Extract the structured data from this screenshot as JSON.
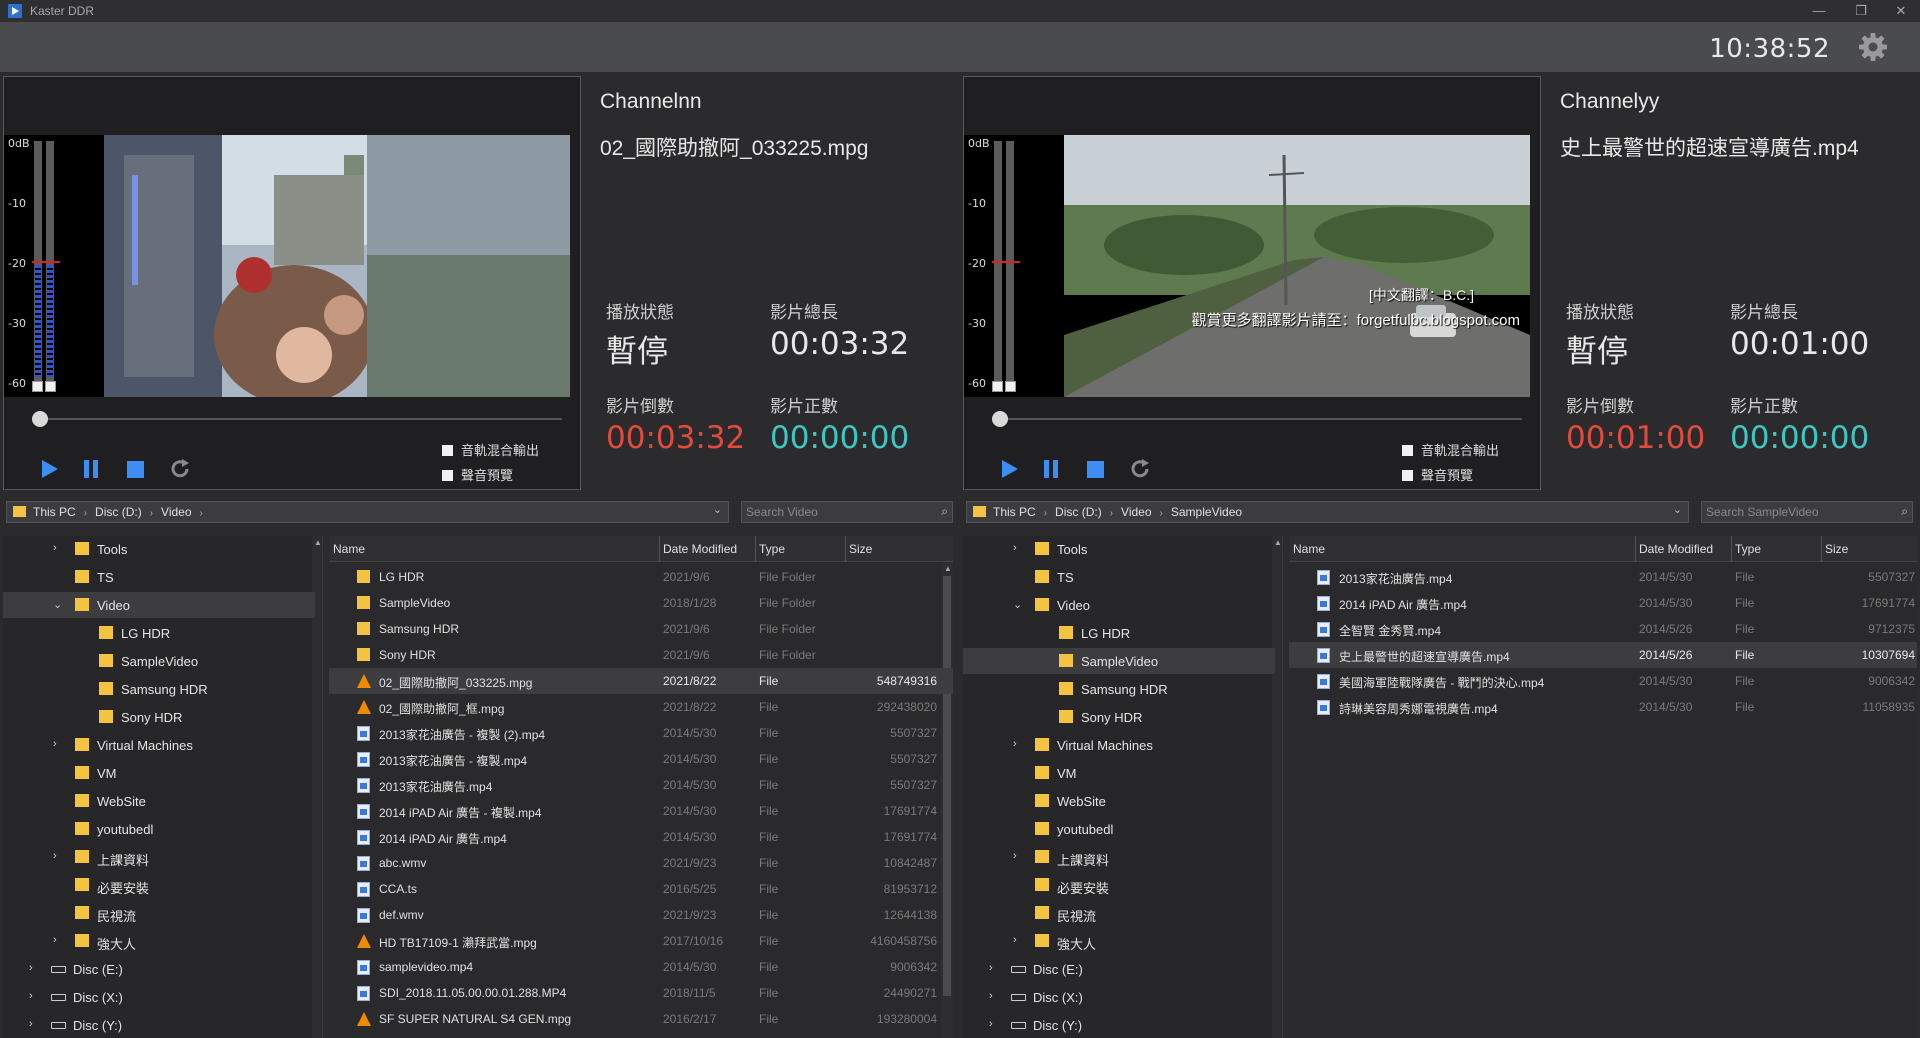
{
  "window": {
    "title": "Kaster DDR"
  },
  "clock": "10:38:52",
  "colors": {
    "countdown": "#e24b3b",
    "countup": "#3ec7c0",
    "folder": "#f5c342"
  },
  "meter": {
    "labels": [
      "0dB",
      "-10",
      "-20",
      "-30",
      "-60"
    ]
  },
  "options": {
    "mix_out": "音軌混合輸出",
    "preview": "聲音預覽"
  },
  "labels": {
    "status": "播放狀態",
    "duration": "影片總長",
    "countdown": "影片倒數",
    "countup": "影片正數"
  },
  "channels": [
    {
      "name": "Channelnn",
      "file": "02_國際助撤阿_033225.mpg",
      "status": "暫停",
      "duration": "00:03:32",
      "countdown": "00:03:32",
      "countup": "00:00:00",
      "path": [
        "This PC",
        "Disc (D:)",
        "Video"
      ],
      "search_placeholder": "Search Video",
      "tree": [
        {
          "label": "Tools",
          "chev": "right",
          "type": "folder",
          "indent": 1
        },
        {
          "label": "TS",
          "chev": "",
          "type": "folder",
          "indent": 1
        },
        {
          "label": "Video",
          "chev": "down",
          "type": "folder",
          "indent": 1,
          "selected": true
        },
        {
          "label": "LG HDR",
          "chev": "",
          "type": "folder",
          "indent": 2
        },
        {
          "label": "SampleVideo",
          "chev": "",
          "type": "folder",
          "indent": 2
        },
        {
          "label": "Samsung HDR",
          "chev": "",
          "type": "folder",
          "indent": 2
        },
        {
          "label": "Sony HDR",
          "chev": "",
          "type": "folder",
          "indent": 2
        },
        {
          "label": "Virtual Machines",
          "chev": "right",
          "type": "folder",
          "indent": 1
        },
        {
          "label": "VM",
          "chev": "",
          "type": "folder",
          "indent": 1
        },
        {
          "label": "WebSite",
          "chev": "",
          "type": "folder",
          "indent": 1
        },
        {
          "label": "youtubedl",
          "chev": "",
          "type": "folder",
          "indent": 1
        },
        {
          "label": "上課資料",
          "chev": "right",
          "type": "folder",
          "indent": 1
        },
        {
          "label": "必要安裝",
          "chev": "",
          "type": "folder",
          "indent": 1
        },
        {
          "label": "民視流",
          "chev": "",
          "type": "folder",
          "indent": 1
        },
        {
          "label": "強大人",
          "chev": "right",
          "type": "folder",
          "indent": 1
        },
        {
          "label": "Disc (E:)",
          "chev": "right",
          "type": "disk",
          "indent": 0
        },
        {
          "label": "Disc (X:)",
          "chev": "right",
          "type": "disk",
          "indent": 0
        },
        {
          "label": "Disc (Y:)",
          "chev": "right",
          "type": "disk",
          "indent": 0
        }
      ],
      "columns": [
        "Name",
        "Date Modified",
        "Type",
        "Size"
      ],
      "files": [
        {
          "icon": "folder",
          "name": "LG HDR",
          "date": "2021/9/6",
          "type": "File Folder",
          "size": ""
        },
        {
          "icon": "folder",
          "name": "SampleVideo",
          "date": "2018/1/28",
          "type": "File Folder",
          "size": ""
        },
        {
          "icon": "folder",
          "name": "Samsung HDR",
          "date": "2021/9/6",
          "type": "File Folder",
          "size": ""
        },
        {
          "icon": "folder",
          "name": "Sony HDR",
          "date": "2021/9/6",
          "type": "File Folder",
          "size": ""
        },
        {
          "icon": "cone",
          "name": "02_國際助撤阿_033225.mpg",
          "date": "2021/8/22",
          "type": "File",
          "size": "548749316",
          "selected": true
        },
        {
          "icon": "cone",
          "name": "02_國際助撤阿_框.mpg",
          "date": "2021/8/22",
          "type": "File",
          "size": "292438020"
        },
        {
          "icon": "doc",
          "name": "2013家花油廣告 - 複製 (2).mp4",
          "date": "2014/5/30",
          "type": "File",
          "size": "5507327"
        },
        {
          "icon": "doc",
          "name": "2013家花油廣告 - 複製.mp4",
          "date": "2014/5/30",
          "type": "File",
          "size": "5507327"
        },
        {
          "icon": "doc",
          "name": "2013家花油廣告.mp4",
          "date": "2014/5/30",
          "type": "File",
          "size": "5507327"
        },
        {
          "icon": "doc",
          "name": "2014 iPAD Air 廣告 - 複製.mp4",
          "date": "2014/5/30",
          "type": "File",
          "size": "17691774"
        },
        {
          "icon": "doc",
          "name": "2014 iPAD Air 廣告.mp4",
          "date": "2014/5/30",
          "type": "File",
          "size": "17691774"
        },
        {
          "icon": "doc",
          "name": "abc.wmv",
          "date": "2021/9/23",
          "type": "File",
          "size": "10842487"
        },
        {
          "icon": "doc",
          "name": "CCA.ts",
          "date": "2016/5/25",
          "type": "File",
          "size": "81953712"
        },
        {
          "icon": "doc",
          "name": "def.wmv",
          "date": "2021/9/23",
          "type": "File",
          "size": "12644138"
        },
        {
          "icon": "cone",
          "name": "HD TB17109-1 瀨拜武當.mpg",
          "date": "2017/10/16",
          "type": "File",
          "size": "4160458756"
        },
        {
          "icon": "doc",
          "name": "samplevideo.mp4",
          "date": "2014/5/30",
          "type": "File",
          "size": "9006342"
        },
        {
          "icon": "doc",
          "name": "SDI_2018.11.05.00.00.01.288.MP4",
          "date": "2018/11/5",
          "type": "File",
          "size": "24490271"
        },
        {
          "icon": "cone",
          "name": "SF SUPER NATURAL S4 GEN.mpg",
          "date": "2016/2/17",
          "type": "File",
          "size": "193280004"
        }
      ]
    },
    {
      "name": "Channelyy",
      "file": "史上最警世的超速宣導廣告.mp4",
      "status": "暫停",
      "duration": "00:01:00",
      "countdown": "00:01:00",
      "countup": "00:00:00",
      "subtitle1": "[中文翻譯：B.C.]",
      "subtitle2": "觀賞更多翻譯影片請至：forgetfulbc.blogspot.com",
      "path": [
        "This PC",
        "Disc (D:)",
        "Video",
        "SampleVideo"
      ],
      "search_placeholder": "Search SampleVideo",
      "tree": [
        {
          "label": "Tools",
          "chev": "right",
          "type": "folder",
          "indent": 1
        },
        {
          "label": "TS",
          "chev": "",
          "type": "folder",
          "indent": 1
        },
        {
          "label": "Video",
          "chev": "down",
          "type": "folder",
          "indent": 1
        },
        {
          "label": "LG HDR",
          "chev": "",
          "type": "folder",
          "indent": 2
        },
        {
          "label": "SampleVideo",
          "chev": "",
          "type": "folder",
          "indent": 2,
          "selected": true
        },
        {
          "label": "Samsung HDR",
          "chev": "",
          "type": "folder",
          "indent": 2
        },
        {
          "label": "Sony HDR",
          "chev": "",
          "type": "folder",
          "indent": 2
        },
        {
          "label": "Virtual Machines",
          "chev": "right",
          "type": "folder",
          "indent": 1
        },
        {
          "label": "VM",
          "chev": "",
          "type": "folder",
          "indent": 1
        },
        {
          "label": "WebSite",
          "chev": "",
          "type": "folder",
          "indent": 1
        },
        {
          "label": "youtubedl",
          "chev": "",
          "type": "folder",
          "indent": 1
        },
        {
          "label": "上課資料",
          "chev": "right",
          "type": "folder",
          "indent": 1
        },
        {
          "label": "必要安裝",
          "chev": "",
          "type": "folder",
          "indent": 1
        },
        {
          "label": "民視流",
          "chev": "",
          "type": "folder",
          "indent": 1
        },
        {
          "label": "強大人",
          "chev": "right",
          "type": "folder",
          "indent": 1
        },
        {
          "label": "Disc (E:)",
          "chev": "right",
          "type": "disk",
          "indent": 0
        },
        {
          "label": "Disc (X:)",
          "chev": "right",
          "type": "disk",
          "indent": 0
        },
        {
          "label": "Disc (Y:)",
          "chev": "right",
          "type": "disk",
          "indent": 0
        }
      ],
      "columns": [
        "Name",
        "Date Modified",
        "Type",
        "Size"
      ],
      "files": [
        {
          "icon": "doc",
          "name": "2013家花油廣告.mp4",
          "date": "2014/5/30",
          "type": "File",
          "size": "5507327"
        },
        {
          "icon": "doc",
          "name": "2014 iPAD Air 廣告.mp4",
          "date": "2014/5/30",
          "type": "File",
          "size": "17691774"
        },
        {
          "icon": "doc",
          "name": "全智賢 金秀賢.mp4",
          "date": "2014/5/26",
          "type": "File",
          "size": "9712375"
        },
        {
          "icon": "doc",
          "name": "史上最警世的超速宣導廣告.mp4",
          "date": "2014/5/26",
          "type": "File",
          "size": "10307694",
          "selected": true
        },
        {
          "icon": "doc",
          "name": "美國海軍陸戰隊廣告 - 戰鬥的決心.mp4",
          "date": "2014/5/30",
          "type": "File",
          "size": "9006342"
        },
        {
          "icon": "doc",
          "name": "詩琳美容周秀娜電視廣告.mp4",
          "date": "2014/5/30",
          "type": "File",
          "size": "11058935"
        }
      ]
    }
  ]
}
